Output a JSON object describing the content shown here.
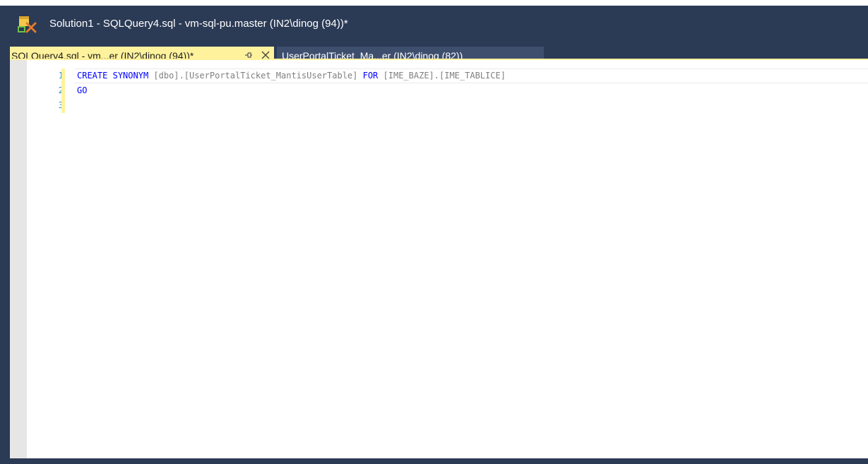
{
  "window": {
    "title": "Solution1 - SQLQuery4.sql - vm-sql-pu.master (IN2\\dinog (94))*",
    "app_icon": "ssms-icon"
  },
  "tabs": [
    {
      "label": "SQLQuery4.sql - vm...er (IN2\\dinog (94))*",
      "active": true,
      "pin_icon": "pin-icon",
      "close_icon": "close-icon"
    },
    {
      "label": "UserPortalTicket_Ma...er (IN2\\dinog (82))",
      "active": false
    }
  ],
  "editor": {
    "line_numbers": [
      "1",
      "2",
      "3"
    ],
    "lines": [
      [
        {
          "t": "CREATE",
          "k": "kw"
        },
        {
          "t": " ",
          "k": "ident"
        },
        {
          "t": "SYNONYM",
          "k": "kw"
        },
        {
          "t": " [dbo].[UserPortalTicket_MantisUserTable] ",
          "k": "ident"
        },
        {
          "t": "FOR",
          "k": "kw"
        },
        {
          "t": " [IME_BAZE].[IME_TABLICE]",
          "k": "ident"
        }
      ],
      [
        {
          "t": "GO",
          "k": "kw"
        }
      ],
      []
    ]
  },
  "colors": {
    "frame": "#2b3a55",
    "active_tab": "#fff29d",
    "inactive_tab": "#3e4f6e",
    "keyword": "#0000ff",
    "line_number": "#2b91af"
  }
}
